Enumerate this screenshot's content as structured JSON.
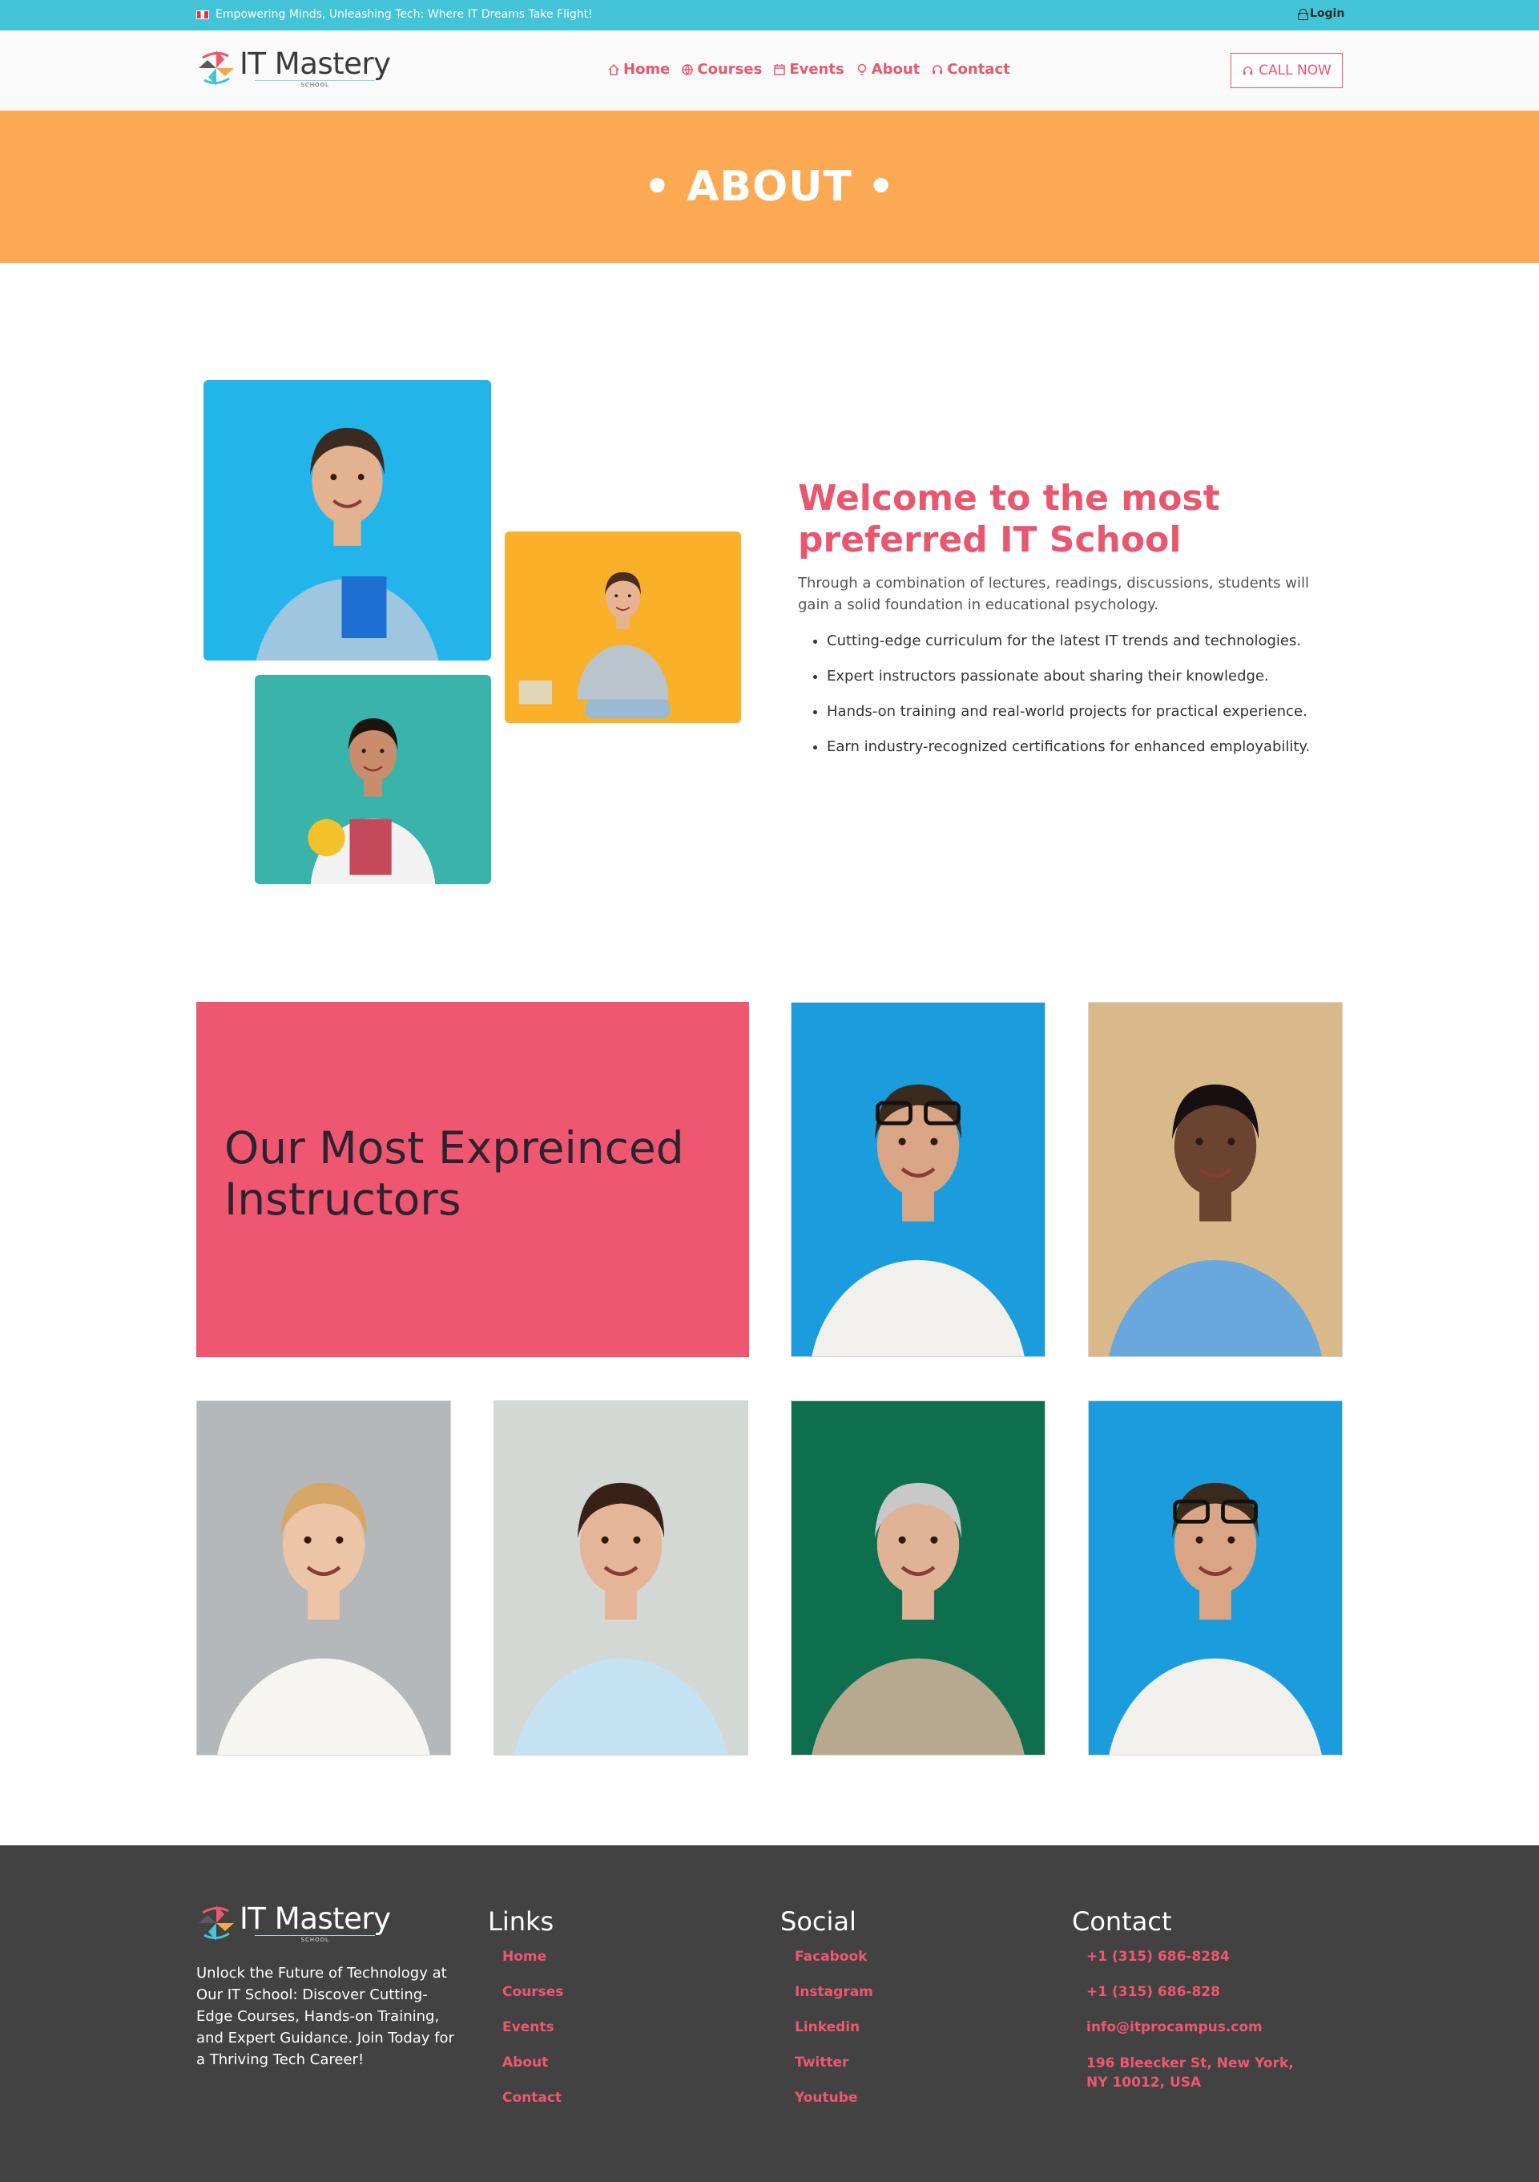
{
  "topbar": {
    "tagline": "Empowering Minds, Unleashing Tech: Where IT Dreams Take Flight!",
    "login": "Login",
    "icons": [
      "flag-icon",
      "lock-icon"
    ]
  },
  "brand": {
    "name": "IT Mastery",
    "sub": "SCHOOL"
  },
  "nav": {
    "items": [
      {
        "label": "Home",
        "icon": "home-icon"
      },
      {
        "label": "Courses",
        "icon": "globe-icon"
      },
      {
        "label": "Events",
        "icon": "calendar-icon"
      },
      {
        "label": "About",
        "icon": "bulb-icon"
      },
      {
        "label": "Contact",
        "icon": "headset-icon"
      }
    ],
    "call_now": "CALL NOW"
  },
  "banner": {
    "title": "• ABOUT •"
  },
  "about": {
    "heading": "Welcome to the most preferred IT School",
    "intro": "Through a combination of lectures, readings, discussions, students will gain a solid foundation in educational psychology.",
    "points": [
      "Cutting-edge curriculum for the latest IT trends and technologies.",
      "Expert instructors passionate about sharing their knowledge.",
      "Hands-on training and real-world projects for practical experience.",
      "Earn industry-recognized certifications for enhanced employability."
    ]
  },
  "instructors": {
    "heading": "Our Most Expreinced Instructors"
  },
  "footer": {
    "about": "Unlock the Future of Technology at Our IT School: Discover Cutting-Edge Courses, Hands-on Training, and Expert Guidance. Join Today for a Thriving Tech Career!",
    "links_title": "Links",
    "links": [
      "Home",
      "Courses",
      "Events",
      "About",
      "Contact"
    ],
    "social_title": "Social",
    "social": [
      "Facabook",
      "Instagram",
      "Linkedin",
      "Twitter",
      "Youtube"
    ],
    "contact_title": "Contact",
    "phone1": "+1 (315) 686-8284",
    "phone2": "+1 (315) 686-828",
    "email": "info@itprocampus.com",
    "address": "196 Bleecker St, New York, NY 10012, USA"
  },
  "colors": {
    "topbar": "#43c4d8",
    "accent": "#e8566f",
    "banner": "#fbaa53",
    "instructor_panel": "#ef5770",
    "footer": "#424242"
  }
}
